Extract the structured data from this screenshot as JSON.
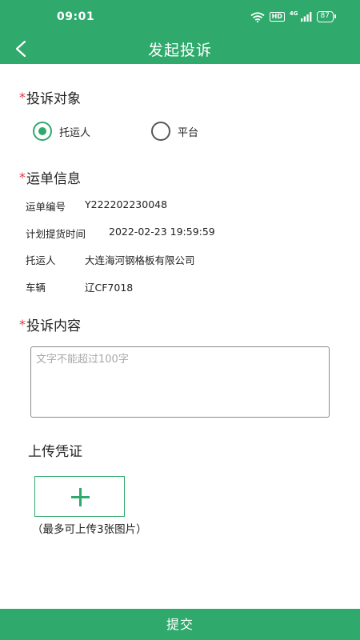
{
  "status_bar": {
    "time": "09:01",
    "icons": [
      "wifi-icon",
      "hd-icon",
      "signal-icon",
      "battery-icon"
    ],
    "hd_label": "HD",
    "signal_label": "4G",
    "battery_level": "87"
  },
  "header": {
    "back_icon": "chevron-left-icon",
    "title": "发起投诉"
  },
  "complaint_target": {
    "required_mark": "*",
    "title": "投诉对象",
    "options": [
      {
        "label": "托运人",
        "selected": true
      },
      {
        "label": "平台",
        "selected": false
      }
    ]
  },
  "waybill_info": {
    "required_mark": "*",
    "title": "运单信息",
    "rows": [
      {
        "label": "运单编号",
        "value": "Y222202230048"
      },
      {
        "label": "计划提货时间",
        "value": "2022-02-23 19:59:59"
      },
      {
        "label": "托运人",
        "value": "大连海河钢格板有限公司"
      },
      {
        "label": "车辆",
        "value": "辽CF7018"
      }
    ]
  },
  "complaint_content": {
    "required_mark": "*",
    "title": "投诉内容",
    "value": "",
    "placeholder": "文字不能超过100字"
  },
  "upload": {
    "title": "上传凭证",
    "add_icon": "plus-icon",
    "hint": "（最多可上传3张图片）"
  },
  "submit": {
    "label": "提交"
  },
  "colors": {
    "primary": "#2fa96c",
    "required": "#e23a3a",
    "placeholder": "#a8a8a8"
  }
}
